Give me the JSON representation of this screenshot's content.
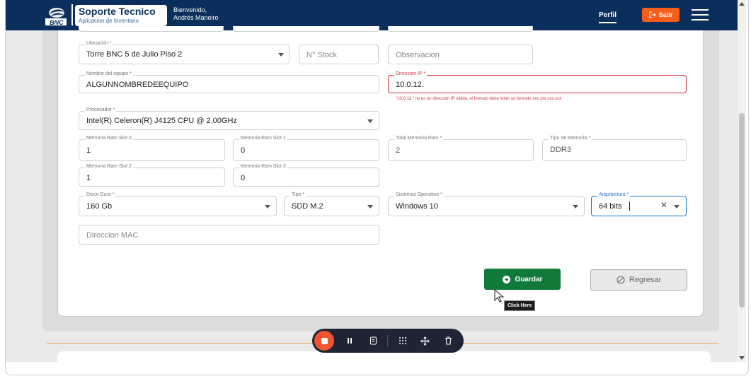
{
  "header": {
    "brand_title": "Soporte Tecnico",
    "brand_subtitle": "Aplicacion de Inventario",
    "logo_text": "BNC",
    "welcome_line1": "Bienvenido,",
    "welcome_line2": "Andrés Maneiro",
    "perfil_label": "Perfil",
    "salir_label": "Salir",
    "colors": {
      "bar": "#0a2f5c",
      "salir": "#f45d1a"
    }
  },
  "form": {
    "ubicacion": {
      "label": "Ubicación *",
      "value": "Torre BNC 5 de Julio Piso 2"
    },
    "stock": {
      "placeholder": "N° Stock"
    },
    "observacion": {
      "placeholder": "Observacion"
    },
    "nombre_equipo": {
      "label": "Nombre del equipo *",
      "value": "ALGUNNOMBREDEEQUIPO"
    },
    "direccion_ip": {
      "label": "Direccion IP *",
      "value": "10.0.12.",
      "error": "\"10.0.12.\" no es un dirección IP válida, el formato debe tener un formato xxx.xxx.xxx.xxx"
    },
    "procesador": {
      "label": "Procesador *",
      "value": "Intel(R) Celeron(R) J4125 CPU @ 2.00GHz"
    },
    "ram_slot0": {
      "label": "Memoria Ram Slot 0",
      "value": "1"
    },
    "ram_slot1": {
      "label": "Memoria Ram Slot 1",
      "value": "0"
    },
    "total_ram": {
      "label": "Total Memoria Ram *",
      "value": "2"
    },
    "tipo_memoria": {
      "label": "Tipo de Memoria *",
      "value": "DDR3"
    },
    "ram_slot2": {
      "label": "Memoria Ram Slot 2",
      "value": "1"
    },
    "ram_slot3": {
      "label": "Memoria Ram Slot 3",
      "value": "0"
    },
    "disco_duro": {
      "label": "Disco Duro *",
      "value": "160 Gb"
    },
    "tipo": {
      "label": "Tipo *",
      "value": "SDD M.2"
    },
    "sistema_operativo": {
      "label": "Sistemas Operativo *",
      "value": "Windows 10"
    },
    "arquitectura": {
      "label": "Arquitectura *",
      "value": "64 bits"
    },
    "mac": {
      "placeholder": "Direccion MAC"
    }
  },
  "actions": {
    "guardar_label": "Guardar",
    "regresar_label": "Regresar",
    "tooltip": "Click Here",
    "colors": {
      "guardar": "#117a3b",
      "error": "#c8343d",
      "focus": "#1976d2"
    }
  },
  "recorder": {
    "icons": [
      "stop-icon",
      "pause-icon",
      "notes-icon",
      "grid-icon",
      "move-icon",
      "trash-icon"
    ],
    "colors": {
      "bar": "#202535",
      "stop": "#f25330"
    }
  }
}
